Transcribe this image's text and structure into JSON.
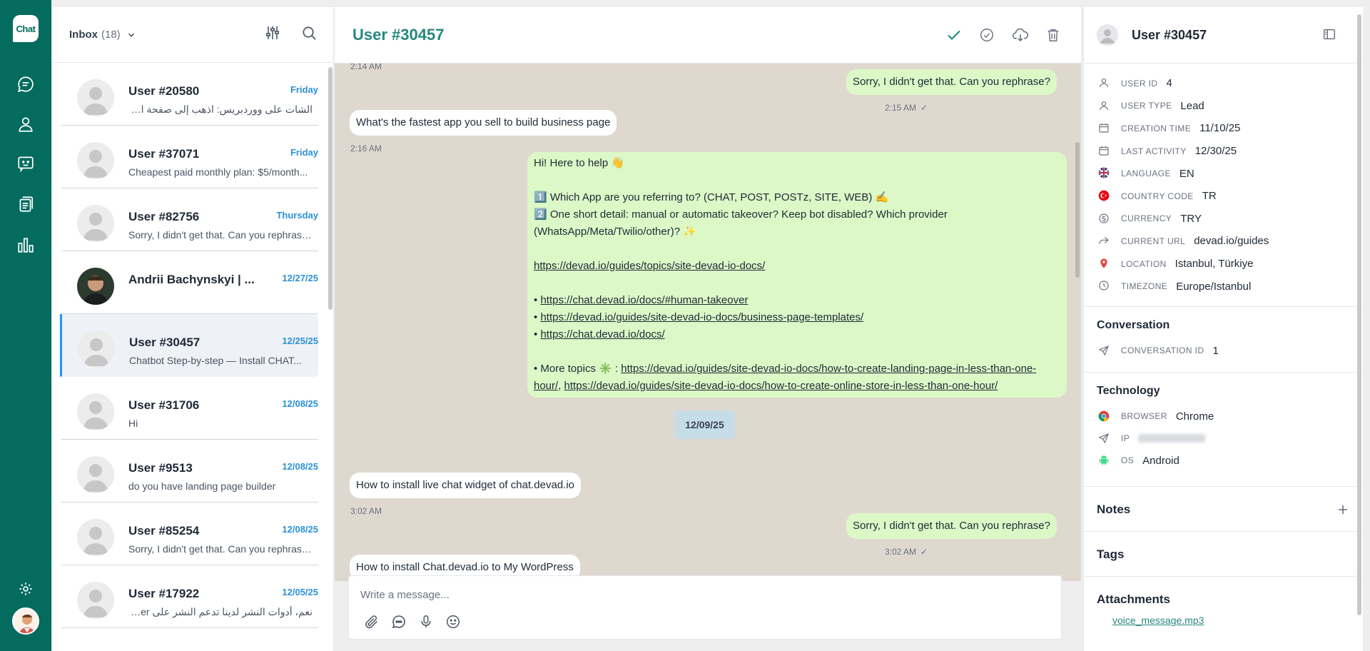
{
  "rail": {
    "logo": "Chat"
  },
  "list": {
    "inbox_label": "Inbox",
    "inbox_count": "(18)",
    "conversations": [
      {
        "name": "User #20580",
        "date": "Friday",
        "preview": "الشات على ووردبريس: اذهب إلى صفحة الإضافات ...",
        "rtl": true,
        "photo": false
      },
      {
        "name": "User #37071",
        "date": "Friday",
        "preview": "Cheapest paid monthly plan: $5/month...",
        "rtl": false,
        "photo": false
      },
      {
        "name": "User #82756",
        "date": "Thursday",
        "preview": "Sorry, I didn't get that. Can you rephrase?",
        "rtl": false,
        "photo": false
      },
      {
        "name": "Andrii Bachynskyi | ...",
        "date": "12/27/25",
        "preview": "",
        "rtl": false,
        "photo": true
      },
      {
        "name": "User #30457",
        "date": "12/25/25",
        "preview": "Chatbot Step-by-step — Install CHAT...",
        "rtl": false,
        "photo": false,
        "active": true
      },
      {
        "name": "User #31706",
        "date": "12/08/25",
        "preview": "Hi",
        "rtl": false,
        "photo": false
      },
      {
        "name": "User #9513",
        "date": "12/08/25",
        "preview": "do you have landing page builder",
        "rtl": false,
        "photo": false
      },
      {
        "name": "User #85254",
        "date": "12/08/25",
        "preview": "Sorry, I didn't get that. Can you rephrase?",
        "rtl": false,
        "photo": false
      },
      {
        "name": "User #17922",
        "date": "12/05/25",
        "preview": "نعم، أدوات النشر لدينا تدعم النشر على Twitter (...",
        "rtl": true,
        "photo": false
      }
    ]
  },
  "chat": {
    "title": "User #30457",
    "messages": {
      "ts_top": "2:14 AM",
      "m1": "Sorry, I didn't get that. Can you rephrase?",
      "m1_time": "2:15 AM",
      "m2": "What's the fastest app you sell to build business page",
      "m2_time": "2:16 AM",
      "m3_l1": "Hi! Here to help 👋",
      "m3_l2": "1️⃣ Which App are you referring to? (CHAT, POST, POSTz, SITE, WEB) ✍️",
      "m3_l3": "2️⃣ One short detail: manual or automatic takeover? Keep bot disabled? Which provider (WhatsApp/Meta/Twilio/other)? ✨",
      "m3_link1": "https://devad.io/guides/topics/site-devad-io-docs/",
      "m3_bullet": "•",
      "m3_link2": "https://chat.devad.io/docs/#human-takeover",
      "m3_link3": "https://devad.io/guides/site-devad-io-docs/business-page-templates/",
      "m3_link4": "https://chat.devad.io/docs/",
      "m3_more": "• More topics ✳️ :",
      "m3_link5": "https://devad.io/guides/site-devad-io-docs/how-to-create-landing-page-in-less-than-one-hour/",
      "m3_link6": "https://devad.io/guides/site-devad-io-docs/how-to-create-online-store-in-less-than-one-hour/",
      "m3_sep": ",",
      "date_chip": "12/09/25",
      "m4": "How to install live chat widget of chat.devad.io",
      "m4_time": "3:02 AM",
      "m5": "Sorry, I didn't get that. Can you rephrase?",
      "m5_time": "3:02 AM",
      "m6": "How to install Chat.devad.io to My WordPress"
    },
    "composer_placeholder": "Write a message..."
  },
  "details": {
    "name": "User #30457",
    "fields": [
      {
        "icon": "user-icon",
        "label": "USER ID",
        "value": "4"
      },
      {
        "icon": "user-icon",
        "label": "USER TYPE",
        "value": "Lead"
      },
      {
        "icon": "calendar-icon",
        "label": "CREATION TIME",
        "value": "11/10/25"
      },
      {
        "icon": "calendar-icon",
        "label": "LAST ACTIVITY",
        "value": "12/30/25"
      },
      {
        "icon": "uk-flag-icon",
        "label": "LANGUAGE",
        "value": "EN"
      },
      {
        "icon": "turkey-flag-icon",
        "label": "COUNTRY CODE",
        "value": "TR"
      },
      {
        "icon": "currency-icon",
        "label": "CURRENCY",
        "value": "TRY"
      },
      {
        "icon": "share-icon",
        "label": "CURRENT URL",
        "value": "devad.io/guides"
      },
      {
        "icon": "map-pin-icon",
        "label": "LOCATION",
        "value": "Istanbul, Türkiye"
      },
      {
        "icon": "clock-icon",
        "label": "TIMEZONE",
        "value": "Europe/Istanbul"
      }
    ],
    "conversation_title": "Conversation",
    "conversation_id_label": "CONVERSATION ID",
    "conversation_id": "1",
    "technology_title": "Technology",
    "browser_label": "BROWSER",
    "browser": "Chrome",
    "ip_label": "IP",
    "os_label": "OS",
    "os": "Android",
    "notes_title": "Notes",
    "tags_title": "Tags",
    "attachments_title": "Attachments",
    "attachment_file": "voice_message.mp3"
  },
  "colors": {
    "rail": "#046b5f",
    "accent": "#26897e",
    "date_blue": "#2b91d9",
    "chat_bg": "#dfd8cf",
    "bubble_out": "#dcf8c6"
  }
}
